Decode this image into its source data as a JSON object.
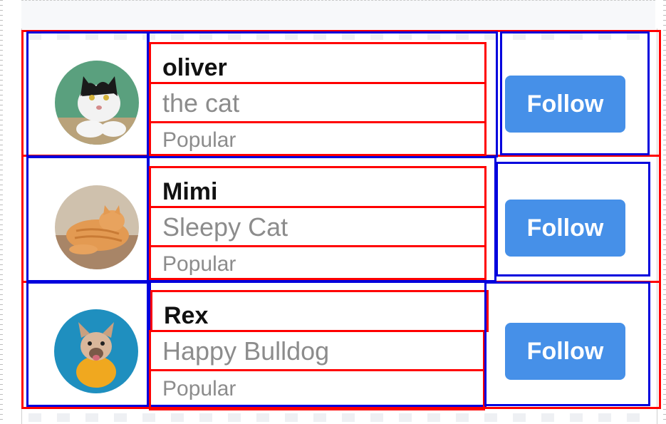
{
  "users": [
    {
      "name": "oliver",
      "subtitle": "the cat",
      "tag": "Popular",
      "avatar_icon": "cat-photo-avatar",
      "follow_label": "Follow"
    },
    {
      "name": "Mimi",
      "subtitle": "Sleepy Cat",
      "tag": "Popular",
      "avatar_icon": "orange-cat-photo-avatar",
      "follow_label": "Follow"
    },
    {
      "name": "Rex",
      "subtitle": "Happy Bulldog",
      "tag": "Popular",
      "avatar_icon": "bulldog-photo-avatar",
      "follow_label": "Follow"
    }
  ],
  "colors": {
    "accent": "#4690e8",
    "debug_red": "#ff0000",
    "debug_blue": "#0000dd"
  }
}
